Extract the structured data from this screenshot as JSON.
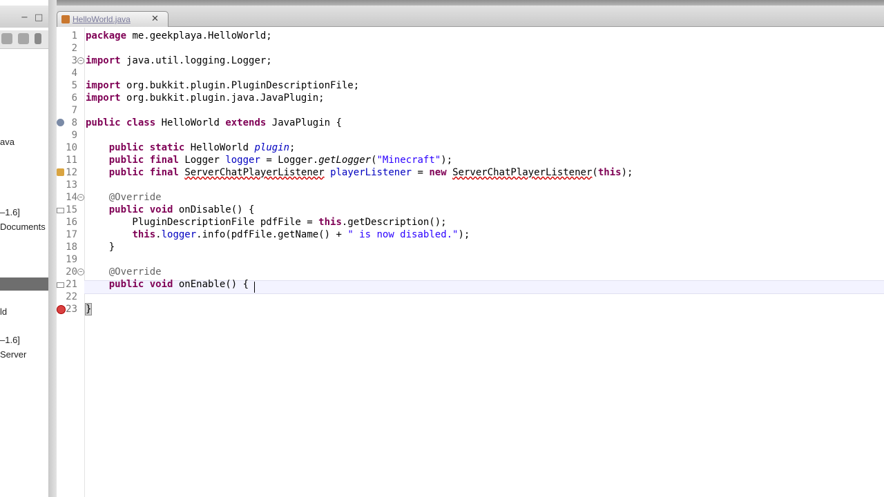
{
  "tab": {
    "label": "HelloWorld.java",
    "close": "✕"
  },
  "sidebar": {
    "items": [
      {
        "label": "ava"
      },
      {
        "label": "–1.6]"
      },
      {
        "label": "Documents"
      },
      {
        "label": "ld"
      },
      {
        "label": "–1.6]"
      },
      {
        "label": "Server"
      }
    ]
  },
  "editor": {
    "lines": [
      {
        "n": "1",
        "code": "package me.geekplaya.HelloWorld;"
      },
      {
        "n": "2",
        "code": ""
      },
      {
        "n": "3",
        "code": "import java.util.logging.Logger;"
      },
      {
        "n": "4",
        "code": ""
      },
      {
        "n": "5",
        "code": "import org.bukkit.plugin.PluginDescriptionFile;"
      },
      {
        "n": "6",
        "code": "import org.bukkit.plugin.java.JavaPlugin;"
      },
      {
        "n": "7",
        "code": ""
      },
      {
        "n": "8",
        "code": "public class HelloWorld extends JavaPlugin {"
      },
      {
        "n": "9",
        "code": ""
      },
      {
        "n": "10",
        "code": "public static HelloWorld plugin;"
      },
      {
        "n": "11",
        "code": "public final Logger logger = Logger.getLogger(\"Minecraft\");"
      },
      {
        "n": "12",
        "code": "public final ServerChatPlayerListener playerListener = new ServerChatPlayerListener(this);"
      },
      {
        "n": "13",
        "code": ""
      },
      {
        "n": "14",
        "code": "@Override"
      },
      {
        "n": "15",
        "code": "public void onDisable() {"
      },
      {
        "n": "16",
        "code": "PluginDescriptionFile pdfFile = this.getDescription();"
      },
      {
        "n": "17",
        "code": "this.logger.info(pdfFile.getName() + \" is now disabled.\");"
      },
      {
        "n": "18",
        "code": "}"
      },
      {
        "n": "19",
        "code": ""
      },
      {
        "n": "20",
        "code": "@Override"
      },
      {
        "n": "21",
        "code": "public void onEnable() {"
      },
      {
        "n": "22",
        "code": ""
      },
      {
        "n": "23",
        "code": "}"
      }
    ]
  },
  "colors": {
    "keyword": "#7f0055",
    "string": "#2a00ff",
    "annotation": "#646464",
    "field": "#0000c0",
    "error": "#d00000"
  }
}
